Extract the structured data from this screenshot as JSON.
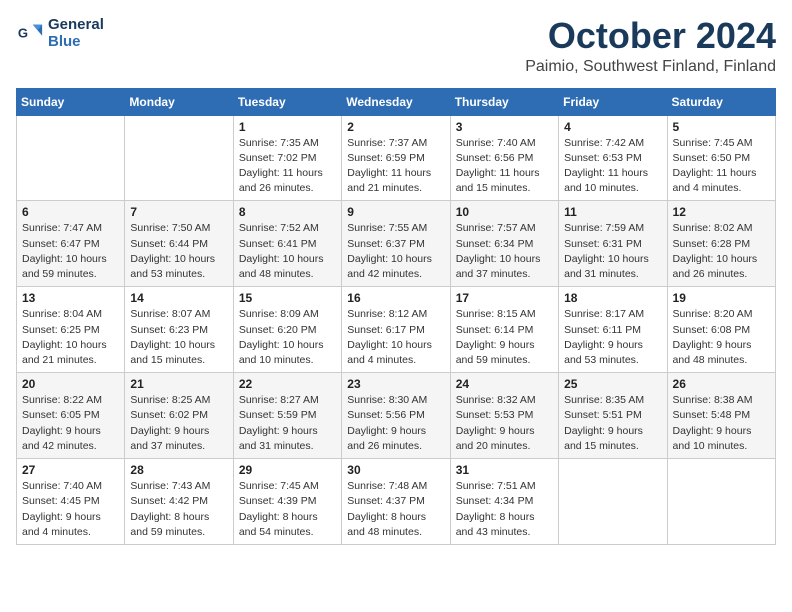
{
  "logo": {
    "line1": "General",
    "line2": "Blue"
  },
  "title": "October 2024",
  "location": "Paimio, Southwest Finland, Finland",
  "days_of_week": [
    "Sunday",
    "Monday",
    "Tuesday",
    "Wednesday",
    "Thursday",
    "Friday",
    "Saturday"
  ],
  "weeks": [
    [
      {
        "day": "",
        "info": ""
      },
      {
        "day": "",
        "info": ""
      },
      {
        "day": "1",
        "info": "Sunrise: 7:35 AM\nSunset: 7:02 PM\nDaylight: 11 hours and 26 minutes."
      },
      {
        "day": "2",
        "info": "Sunrise: 7:37 AM\nSunset: 6:59 PM\nDaylight: 11 hours and 21 minutes."
      },
      {
        "day": "3",
        "info": "Sunrise: 7:40 AM\nSunset: 6:56 PM\nDaylight: 11 hours and 15 minutes."
      },
      {
        "day": "4",
        "info": "Sunrise: 7:42 AM\nSunset: 6:53 PM\nDaylight: 11 hours and 10 minutes."
      },
      {
        "day": "5",
        "info": "Sunrise: 7:45 AM\nSunset: 6:50 PM\nDaylight: 11 hours and 4 minutes."
      }
    ],
    [
      {
        "day": "6",
        "info": "Sunrise: 7:47 AM\nSunset: 6:47 PM\nDaylight: 10 hours and 59 minutes."
      },
      {
        "day": "7",
        "info": "Sunrise: 7:50 AM\nSunset: 6:44 PM\nDaylight: 10 hours and 53 minutes."
      },
      {
        "day": "8",
        "info": "Sunrise: 7:52 AM\nSunset: 6:41 PM\nDaylight: 10 hours and 48 minutes."
      },
      {
        "day": "9",
        "info": "Sunrise: 7:55 AM\nSunset: 6:37 PM\nDaylight: 10 hours and 42 minutes."
      },
      {
        "day": "10",
        "info": "Sunrise: 7:57 AM\nSunset: 6:34 PM\nDaylight: 10 hours and 37 minutes."
      },
      {
        "day": "11",
        "info": "Sunrise: 7:59 AM\nSunset: 6:31 PM\nDaylight: 10 hours and 31 minutes."
      },
      {
        "day": "12",
        "info": "Sunrise: 8:02 AM\nSunset: 6:28 PM\nDaylight: 10 hours and 26 minutes."
      }
    ],
    [
      {
        "day": "13",
        "info": "Sunrise: 8:04 AM\nSunset: 6:25 PM\nDaylight: 10 hours and 21 minutes."
      },
      {
        "day": "14",
        "info": "Sunrise: 8:07 AM\nSunset: 6:23 PM\nDaylight: 10 hours and 15 minutes."
      },
      {
        "day": "15",
        "info": "Sunrise: 8:09 AM\nSunset: 6:20 PM\nDaylight: 10 hours and 10 minutes."
      },
      {
        "day": "16",
        "info": "Sunrise: 8:12 AM\nSunset: 6:17 PM\nDaylight: 10 hours and 4 minutes."
      },
      {
        "day": "17",
        "info": "Sunrise: 8:15 AM\nSunset: 6:14 PM\nDaylight: 9 hours and 59 minutes."
      },
      {
        "day": "18",
        "info": "Sunrise: 8:17 AM\nSunset: 6:11 PM\nDaylight: 9 hours and 53 minutes."
      },
      {
        "day": "19",
        "info": "Sunrise: 8:20 AM\nSunset: 6:08 PM\nDaylight: 9 hours and 48 minutes."
      }
    ],
    [
      {
        "day": "20",
        "info": "Sunrise: 8:22 AM\nSunset: 6:05 PM\nDaylight: 9 hours and 42 minutes."
      },
      {
        "day": "21",
        "info": "Sunrise: 8:25 AM\nSunset: 6:02 PM\nDaylight: 9 hours and 37 minutes."
      },
      {
        "day": "22",
        "info": "Sunrise: 8:27 AM\nSunset: 5:59 PM\nDaylight: 9 hours and 31 minutes."
      },
      {
        "day": "23",
        "info": "Sunrise: 8:30 AM\nSunset: 5:56 PM\nDaylight: 9 hours and 26 minutes."
      },
      {
        "day": "24",
        "info": "Sunrise: 8:32 AM\nSunset: 5:53 PM\nDaylight: 9 hours and 20 minutes."
      },
      {
        "day": "25",
        "info": "Sunrise: 8:35 AM\nSunset: 5:51 PM\nDaylight: 9 hours and 15 minutes."
      },
      {
        "day": "26",
        "info": "Sunrise: 8:38 AM\nSunset: 5:48 PM\nDaylight: 9 hours and 10 minutes."
      }
    ],
    [
      {
        "day": "27",
        "info": "Sunrise: 7:40 AM\nSunset: 4:45 PM\nDaylight: 9 hours and 4 minutes."
      },
      {
        "day": "28",
        "info": "Sunrise: 7:43 AM\nSunset: 4:42 PM\nDaylight: 8 hours and 59 minutes."
      },
      {
        "day": "29",
        "info": "Sunrise: 7:45 AM\nSunset: 4:39 PM\nDaylight: 8 hours and 54 minutes."
      },
      {
        "day": "30",
        "info": "Sunrise: 7:48 AM\nSunset: 4:37 PM\nDaylight: 8 hours and 48 minutes."
      },
      {
        "day": "31",
        "info": "Sunrise: 7:51 AM\nSunset: 4:34 PM\nDaylight: 8 hours and 43 minutes."
      },
      {
        "day": "",
        "info": ""
      },
      {
        "day": "",
        "info": ""
      }
    ]
  ]
}
